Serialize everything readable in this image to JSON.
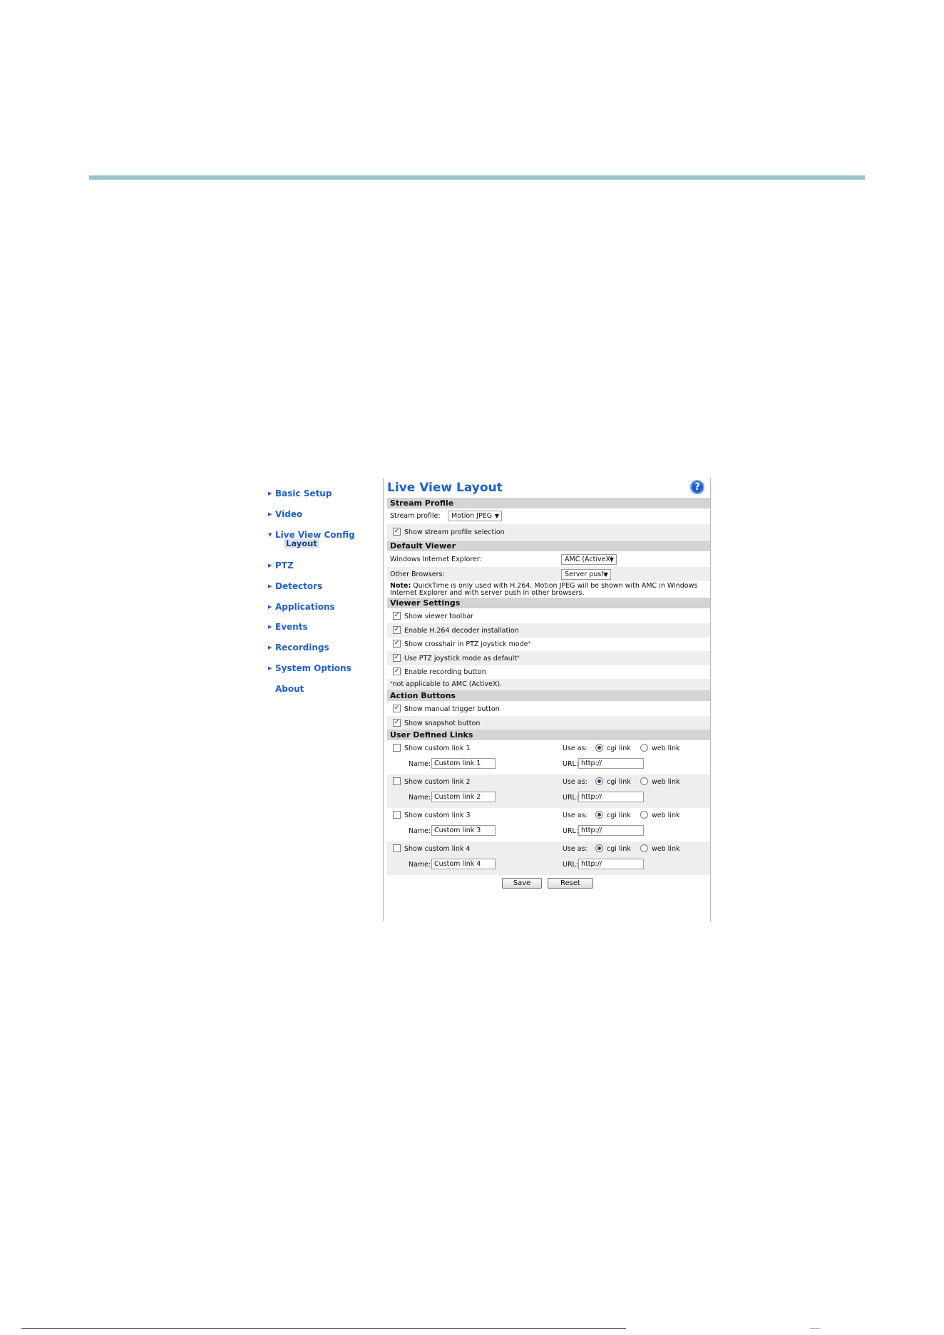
{
  "sidebar": {
    "items": [
      {
        "label": "Basic Setup"
      },
      {
        "label": "Video"
      },
      {
        "label": "Live View Config"
      },
      {
        "label": "PTZ"
      },
      {
        "label": "Detectors"
      },
      {
        "label": "Applications"
      },
      {
        "label": "Events"
      },
      {
        "label": "Recordings"
      },
      {
        "label": "System Options"
      },
      {
        "label": "About"
      }
    ],
    "sub_item": "Layout"
  },
  "main": {
    "title": "Live View Layout",
    "help_glyph": "?",
    "stream_profile": {
      "header": "Stream Profile",
      "label": "Stream profile:",
      "value": "Motion JPEG",
      "show_selection_label": "Show stream profile selection",
      "show_selection_checked": true
    },
    "default_viewer": {
      "header": "Default Viewer",
      "ie_label": "Windows Internet Explorer:",
      "ie_value": "AMC (ActiveX)",
      "other_label": "Other Browsers:",
      "other_value": "Server push",
      "note_bold": "Note:",
      "note_text": " QuickTime is only used with H.264. Motion JPEG will be shown with AMC in Windows Internet Explorer and with server push in other browsers."
    },
    "viewer_settings": {
      "header": "Viewer Settings",
      "items": [
        {
          "label": "Show viewer toolbar",
          "checked": true,
          "asterisk": ""
        },
        {
          "label": "Enable H.264 decoder installation",
          "checked": true,
          "asterisk": ""
        },
        {
          "label": "Show crosshair in PTZ joystick mode",
          "checked": true,
          "asterisk": "*"
        },
        {
          "label": "Use PTZ joystick mode as default",
          "checked": true,
          "asterisk": "*"
        },
        {
          "label": "Enable recording button",
          "checked": true,
          "asterisk": ""
        }
      ],
      "footnote_mark": "*",
      "footnote": "not applicable to AMC (ActiveX)."
    },
    "action_buttons": {
      "header": "Action Buttons",
      "items": [
        {
          "label": "Show manual trigger button",
          "checked": true
        },
        {
          "label": "Show snapshot button",
          "checked": true
        }
      ]
    },
    "user_links": {
      "header": "User Defined Links",
      "use_as_label": "Use as:",
      "cgi_label": "cgi link",
      "web_label": "web link",
      "name_label": "Name:",
      "url_label": "URL:",
      "links": [
        {
          "label": "Show custom link 1",
          "name": "Custom link 1",
          "url": "http://"
        },
        {
          "label": "Show custom link 2",
          "name": "Custom link 2",
          "url": "http://"
        },
        {
          "label": "Show custom link 3",
          "name": "Custom link 3",
          "url": "http://"
        },
        {
          "label": "Show custom link 4",
          "name": "Custom link 4",
          "url": "http://"
        }
      ]
    },
    "save_label": "Save",
    "reset_label": "Reset"
  },
  "colors": {
    "accent": "#1f5fd0",
    "rule": "#99c0cc",
    "section_header": "#d4d4d4"
  }
}
